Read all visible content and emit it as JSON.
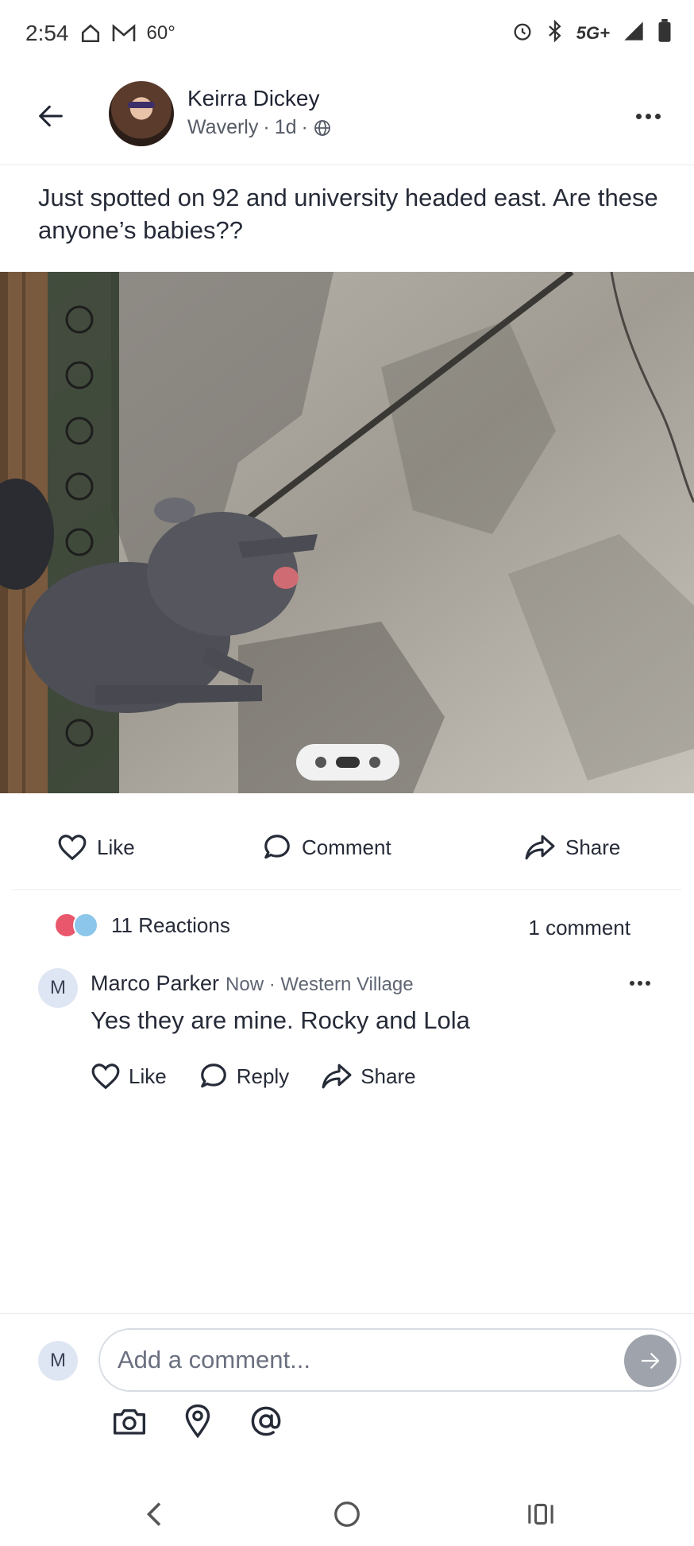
{
  "status_bar": {
    "time": "2:54",
    "temperature": "60°",
    "network": "5G+",
    "icons": [
      "home-icon",
      "gmail-icon",
      "alarm-icon",
      "bluetooth-icon",
      "signal-icon",
      "battery-icon"
    ]
  },
  "post": {
    "author": "Keirra Dickey",
    "neighborhood": "Waverly",
    "age": "1d",
    "separator": "·",
    "text": "Just spotted on 92 and university headed east. Are these anyone’s babies??",
    "photo_pages": 3,
    "photo_active_page": 2
  },
  "actions": {
    "like": "Like",
    "comment": "Comment",
    "share": "Share"
  },
  "engagement": {
    "reactions": "11 Reactions",
    "comments": "1 comment"
  },
  "comment": {
    "avatar_initial": "M",
    "author": "Marco Parker",
    "meta": "Now · Western Village",
    "text": "Yes they are mine. Rocky and Lola",
    "like": "Like",
    "reply": "Reply",
    "share": "Share"
  },
  "composer": {
    "avatar_initial": "M",
    "placeholder": "Add a comment..."
  },
  "colors": {
    "text": "#262b38",
    "reaction_heart": "#e8576b",
    "reaction_sad": "#8cc6ea",
    "send_button": "#9fa3ab"
  }
}
